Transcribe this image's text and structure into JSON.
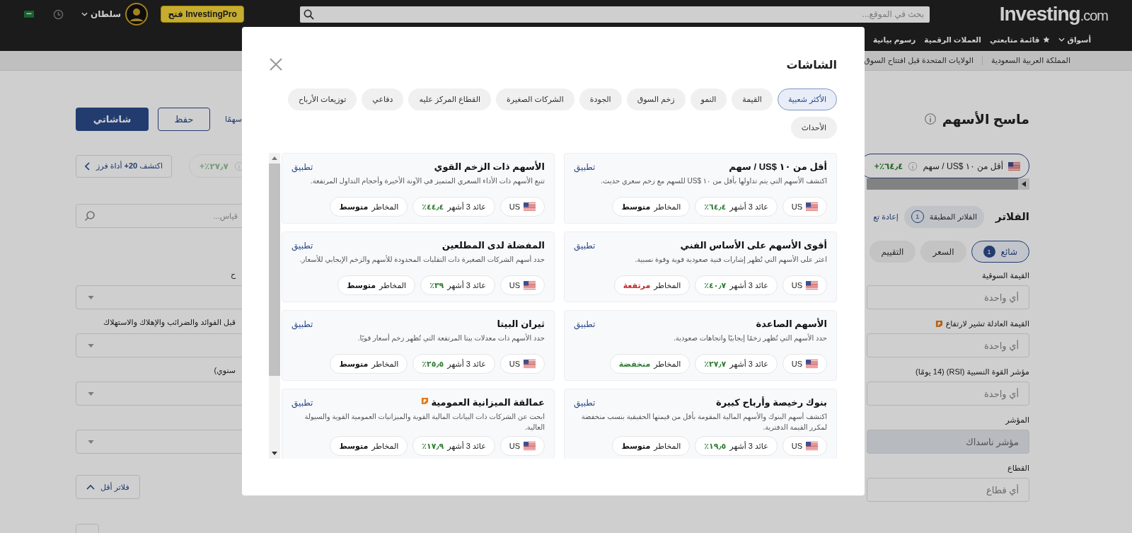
{
  "header": {
    "logo": {
      "name": "Investing",
      "suffix": ".com"
    },
    "search": {
      "placeholder": "بحث في الموقع..."
    },
    "pro_button": "فتح InvestingPro",
    "user": "سلطان",
    "nav": [
      {
        "label": "أسواق",
        "kind": "menu"
      },
      {
        "label": "قائمة متابعتي",
        "kind": "star"
      },
      {
        "label": "العملات الرقمية",
        "kind": "plain"
      },
      {
        "label": "رسوم بيانية",
        "kind": "plain"
      }
    ]
  },
  "breadcrumb": [
    "المملكة العربية السعودية",
    "الولايات المتحدة قبل افتتاح السوق"
  ],
  "left": {
    "my_screens": "شاشاتي",
    "save": "حفظ",
    "count": "سهمًا",
    "discover": "اكتشف **20+** أداة فرز",
    "preset_return": "+٪٢٧٫٧",
    "search_placeholder": "قياس...",
    "fields": [
      {
        "kind": "labeled",
        "label": "ح"
      },
      {
        "kind": "labeled",
        "label": "قبل الفوائد والضرائب والإهلاك والاستهلاك"
      },
      {
        "kind": "labeled",
        "label": "سنوي)"
      },
      {
        "kind": "unlabeled"
      }
    ],
    "fewer_filters": "فلاتر أقل"
  },
  "right": {
    "title": "ماسح الأسهم",
    "preset": {
      "label": "أقل من ١٠ $US / سهم",
      "return": "+٪٦٤٫٤",
      "selected": true
    },
    "filters_title": "الفلاتر",
    "applied": {
      "label": "الفلاتر المطبقة",
      "count": "1"
    },
    "reset": "إعادة تع",
    "tabs": [
      {
        "label": "شائع",
        "badge": "1",
        "selected": true
      },
      {
        "label": "السعر",
        "selected": false
      },
      {
        "label": "التقييم",
        "selected": false
      }
    ],
    "fields": [
      {
        "label": "القيمة السوقية",
        "value": "أي واحدة",
        "filled": false,
        "pro": false
      },
      {
        "label": "القيمة العادلة تشير لارتفاع",
        "value": "أي واحدة",
        "filled": false,
        "pro": true
      },
      {
        "label": "مؤشر القوة النسبية (RSI) (14 يومًا)",
        "value": "أي واحدة",
        "filled": false,
        "pro": false
      },
      {
        "label": "المؤشر",
        "value": "مؤشر ناسداك",
        "filled": true,
        "pro": false
      },
      {
        "label": "القطاع",
        "value": "أي قطاع",
        "filled": false,
        "pro": false
      }
    ]
  },
  "modal": {
    "title": "الشاشات",
    "categories": [
      {
        "label": "الأكثر شعبية",
        "selected": true
      },
      {
        "label": "القيمة",
        "selected": false
      },
      {
        "label": "النمو",
        "selected": false
      },
      {
        "label": "زخم السوق",
        "selected": false
      },
      {
        "label": "الجودة",
        "selected": false
      },
      {
        "label": "الشركات الصغيرة",
        "selected": false
      },
      {
        "label": "القطاع المركز عليه",
        "selected": false
      },
      {
        "label": "دفاعي",
        "selected": false
      },
      {
        "label": "توزيعات الأرباح",
        "selected": false
      },
      {
        "label": "الأحداث",
        "selected": false
      }
    ],
    "cards": [
      {
        "title": "أقل من ١٠ $US / سهم",
        "pro": false,
        "apply": "تطبيق",
        "description": "اكتشف الأسهم التي يتم تداولها بأقل من ١٠ $US للسهم مع زخم سعري حديث.",
        "country": "US",
        "return_label": "عائد 3 أشهر",
        "return": "٪٦٤٫٤",
        "risk_label": "المخاطر",
        "risk": "متوسط",
        "color": "#111111"
      },
      {
        "title": "الأسهم ذات الزخم القوي",
        "pro": false,
        "apply": "تطبيق",
        "description": "تتبع الأسهم ذات الأداء السعري المتميز في الآونة الأخيرة وأحجام التداول المرتفعة.",
        "country": "US",
        "return_label": "عائد 3 أشهر",
        "return": "٪٤٤٫٤",
        "risk_label": "المخاطر",
        "risk": "متوسط",
        "color": "#111111"
      },
      {
        "title": "أقوى الأسهم على الأساس الفني",
        "pro": false,
        "apply": "تطبيق",
        "description": "اعثر على الأسهم التي تُظهر إشارات فنية صعودية قوية وقوة نسبية.",
        "country": "US",
        "return_label": "عائد 3 أشهر",
        "return": "٪٤٠٫٧",
        "risk_label": "المخاطر",
        "risk": "مرتفعة",
        "color": "#c62828"
      },
      {
        "title": "المفضلة لدى المطلعين",
        "pro": false,
        "apply": "تطبيق",
        "description": "حدد أسهم الشركات الصغيرة ذات التقلبات المحدودة للأسهم والزخم الإيجابي للأسعار.",
        "country": "US",
        "return_label": "عائد 3 أشهر",
        "return": "٪٣٩",
        "risk_label": "المخاطر",
        "risk": "متوسط",
        "color": "#111111"
      },
      {
        "title": "الأسهم الصاعدة",
        "pro": false,
        "apply": "تطبيق",
        "description": "حدد الأسهم التي تُظهر زخمًا إيجابيًا واتجاهات صعودية.",
        "country": "US",
        "return_label": "عائد 3 أشهر",
        "return": "٪٢٧٫٧",
        "risk_label": "المخاطر",
        "risk": "منخفضة",
        "color": "#2e7d32"
      },
      {
        "title": "ثيران البيتا",
        "pro": false,
        "apply": "تطبيق",
        "description": "حدد الأسهم ذات معدلات بيتا المرتفعة التي تُظهر زخم أسعار قويًا.",
        "country": "US",
        "return_label": "عائد 3 أشهر",
        "return": "٪٢٥٫٥",
        "risk_label": "المخاطر",
        "risk": "متوسط",
        "color": "#111111"
      },
      {
        "title": "بنوك رخيصة وأرباح كبيرة",
        "pro": false,
        "apply": "تطبيق",
        "description": "اكتشف أسهم البنوك والأسهم المالية المقومة بأقل من قيمتها الحقيقية بنسب منخفضة لمكرر القيمة الدفترية.",
        "country": "US",
        "return_label": "عائد 3 أشهر",
        "return": "٪١٩٫٥",
        "risk_label": "المخاطر",
        "risk": "متوسط",
        "color": "#111111"
      },
      {
        "title": "عمالقة الميزانية العمومية",
        "pro": true,
        "apply": "تطبيق",
        "description": "ابحث عن الشركات ذات البيانات المالية القوية والميزانيات العمومية القوية والسيولة العالية.",
        "country": "US",
        "return_label": "عائد 3 أشهر",
        "return": "٪١٧٫٩",
        "risk_label": "المخاطر",
        "risk": "متوسط",
        "color": "#111111"
      }
    ]
  }
}
